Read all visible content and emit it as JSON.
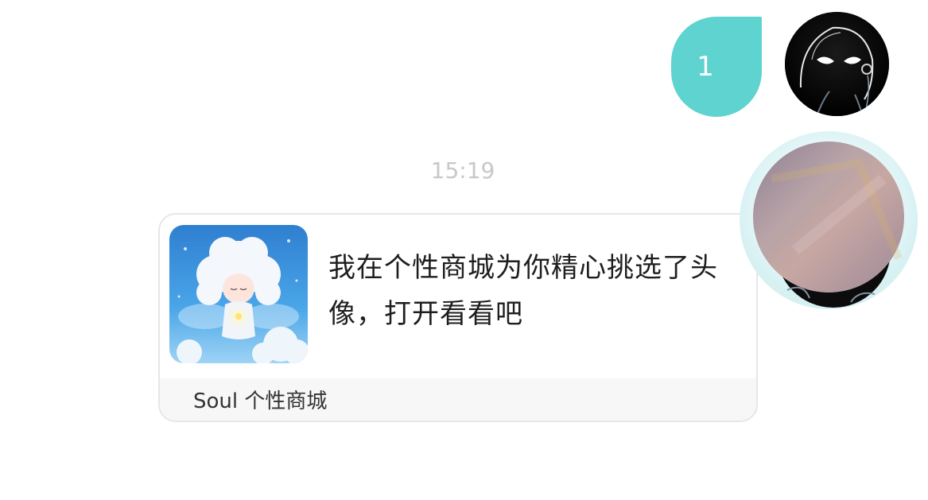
{
  "chat": {
    "outgoing_message": "1",
    "timestamp": "15:19"
  },
  "share_card": {
    "message": "我在个性商城为你精心挑选了头像，打开看看吧",
    "source": "Soul 个性商城",
    "thumbnail_icon": "cloud-fairy-avatar-image"
  },
  "colors": {
    "outgoing_bubble": "#5ed3cf",
    "timestamp_text": "#c8c8c8",
    "card_border": "#e6e6e6",
    "card_footer_bg": "#f7f7f7"
  },
  "icons": {
    "own_avatar": "anime-avatar-icon",
    "floating_avatar": "profile-avatar-icon"
  }
}
